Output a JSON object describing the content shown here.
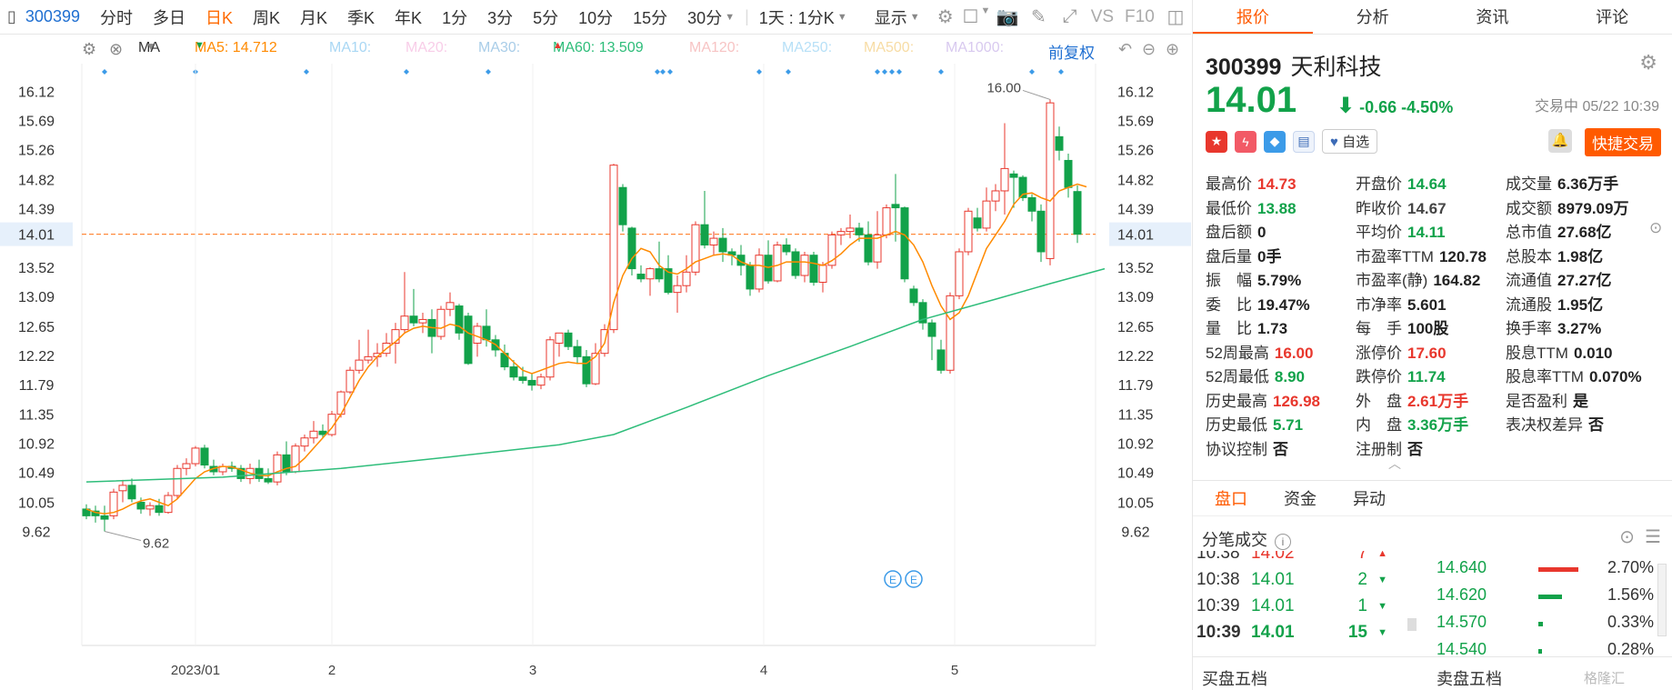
{
  "toolbar": {
    "code": "300399",
    "periods": [
      "分时",
      "多日",
      "日K",
      "周K",
      "月K",
      "季K",
      "年K",
      "1分",
      "3分",
      "5分",
      "10分",
      "15分",
      "30分"
    ],
    "range": "1天 : 1分K",
    "display": "显示",
    "vs": "VS",
    "f10": "F10"
  },
  "indicator": {
    "type": "MA",
    "ma5": "MA5: 14.712",
    "ma10": "MA10:",
    "ma20": "MA20:",
    "ma30": "MA30:",
    "ma60": "MA60: 13.509",
    "ma120": "MA120:",
    "ma250": "MA250:",
    "ma500": "MA500:",
    "ma1000": "MA1000:",
    "adjust": "前复权",
    "ma5_color": "#ff8a00",
    "ma60_color": "#2ebd7a"
  },
  "chart_data": {
    "type": "candlestick",
    "title": "",
    "ylim": [
      9.4,
      16.5
    ],
    "y_ticks": [
      "16.12",
      "15.69",
      "15.26",
      "14.82",
      "14.39",
      "14.01",
      "13.52",
      "13.09",
      "12.65",
      "12.22",
      "11.79",
      "11.35",
      "10.92",
      "10.49",
      "10.05",
      "9.62"
    ],
    "x_ticks": [
      "2023/01",
      "2",
      "3",
      "4",
      "5"
    ],
    "current_price": "14.01",
    "max_label": "16.00",
    "min_label": "9.62",
    "colors": {
      "up": "#e8372d",
      "down": "#12a24a",
      "ma5": "#ff8a00",
      "ma60": "#2ebd7a",
      "current_line": "#ff8a3d"
    },
    "candles": [
      {
        "o": 9.95,
        "h": 10.02,
        "l": 9.8,
        "c": 9.85
      },
      {
        "o": 9.92,
        "h": 10.0,
        "l": 9.75,
        "c": 9.85
      },
      {
        "o": 9.85,
        "h": 10.0,
        "l": 9.62,
        "c": 9.8
      },
      {
        "o": 9.85,
        "h": 10.25,
        "l": 9.8,
        "c": 10.2
      },
      {
        "o": 10.22,
        "h": 10.38,
        "l": 10.05,
        "c": 10.3
      },
      {
        "o": 10.3,
        "h": 10.4,
        "l": 10.05,
        "c": 10.1
      },
      {
        "o": 10.05,
        "h": 10.12,
        "l": 9.88,
        "c": 9.95
      },
      {
        "o": 9.95,
        "h": 10.05,
        "l": 9.85,
        "c": 10.0
      },
      {
        "o": 10.0,
        "h": 10.1,
        "l": 9.85,
        "c": 9.9
      },
      {
        "o": 9.9,
        "h": 10.2,
        "l": 9.88,
        "c": 10.15
      },
      {
        "o": 10.15,
        "h": 10.6,
        "l": 10.1,
        "c": 10.55
      },
      {
        "o": 10.55,
        "h": 10.7,
        "l": 10.45,
        "c": 10.62
      },
      {
        "o": 10.62,
        "h": 10.88,
        "l": 10.58,
        "c": 10.85
      },
      {
        "o": 10.85,
        "h": 10.9,
        "l": 10.55,
        "c": 10.6
      },
      {
        "o": 10.58,
        "h": 10.68,
        "l": 10.45,
        "c": 10.5
      },
      {
        "o": 10.5,
        "h": 10.62,
        "l": 10.45,
        "c": 10.58
      },
      {
        "o": 10.58,
        "h": 10.65,
        "l": 10.5,
        "c": 10.55
      },
      {
        "o": 10.55,
        "h": 10.6,
        "l": 10.35,
        "c": 10.4
      },
      {
        "o": 10.4,
        "h": 10.62,
        "l": 10.32,
        "c": 10.55
      },
      {
        "o": 10.55,
        "h": 10.68,
        "l": 10.35,
        "c": 10.4
      },
      {
        "o": 10.4,
        "h": 10.55,
        "l": 10.32,
        "c": 10.35
      },
      {
        "o": 10.35,
        "h": 10.8,
        "l": 10.3,
        "c": 10.75
      },
      {
        "o": 10.75,
        "h": 10.95,
        "l": 10.45,
        "c": 10.5
      },
      {
        "o": 10.5,
        "h": 10.92,
        "l": 10.48,
        "c": 10.88
      },
      {
        "o": 10.88,
        "h": 11.05,
        "l": 10.8,
        "c": 11.0
      },
      {
        "o": 11.0,
        "h": 11.25,
        "l": 10.92,
        "c": 11.1
      },
      {
        "o": 11.1,
        "h": 11.2,
        "l": 11.0,
        "c": 11.05
      },
      {
        "o": 11.05,
        "h": 11.4,
        "l": 11.02,
        "c": 11.35
      },
      {
        "o": 11.35,
        "h": 11.7,
        "l": 11.3,
        "c": 11.68
      },
      {
        "o": 11.68,
        "h": 12.05,
        "l": 11.65,
        "c": 12.0
      },
      {
        "o": 12.0,
        "h": 12.45,
        "l": 11.95,
        "c": 12.15
      },
      {
        "o": 12.15,
        "h": 12.6,
        "l": 12.1,
        "c": 12.2
      },
      {
        "o": 12.2,
        "h": 12.4,
        "l": 12.05,
        "c": 12.25
      },
      {
        "o": 12.25,
        "h": 12.55,
        "l": 12.2,
        "c": 12.4
      },
      {
        "o": 12.4,
        "h": 12.7,
        "l": 12.1,
        "c": 12.6
      },
      {
        "o": 12.6,
        "h": 13.45,
        "l": 12.55,
        "c": 12.8
      },
      {
        "o": 12.8,
        "h": 13.2,
        "l": 12.65,
        "c": 12.7
      },
      {
        "o": 12.7,
        "h": 12.85,
        "l": 12.55,
        "c": 12.75
      },
      {
        "o": 12.75,
        "h": 12.9,
        "l": 12.25,
        "c": 12.5
      },
      {
        "o": 12.5,
        "h": 12.95,
        "l": 12.45,
        "c": 12.9
      },
      {
        "o": 12.9,
        "h": 13.15,
        "l": 12.8,
        "c": 13.0
      },
      {
        "o": 12.95,
        "h": 12.98,
        "l": 12.45,
        "c": 12.55
      },
      {
        "o": 12.8,
        "h": 12.85,
        "l": 12.08,
        "c": 12.1
      },
      {
        "o": 12.4,
        "h": 12.7,
        "l": 12.2,
        "c": 12.65
      },
      {
        "o": 12.65,
        "h": 12.9,
        "l": 12.35,
        "c": 12.45
      },
      {
        "o": 12.45,
        "h": 12.52,
        "l": 12.2,
        "c": 12.3
      },
      {
        "o": 12.25,
        "h": 12.38,
        "l": 12.0,
        "c": 12.05
      },
      {
        "o": 12.05,
        "h": 12.15,
        "l": 11.85,
        "c": 11.9
      },
      {
        "o": 11.9,
        "h": 12.05,
        "l": 11.8,
        "c": 11.85
      },
      {
        "o": 11.85,
        "h": 11.95,
        "l": 11.7,
        "c": 11.78
      },
      {
        "o": 11.78,
        "h": 11.95,
        "l": 11.72,
        "c": 11.9
      },
      {
        "o": 11.9,
        "h": 12.5,
        "l": 11.85,
        "c": 12.45
      },
      {
        "o": 12.4,
        "h": 12.55,
        "l": 12.2,
        "c": 12.55
      },
      {
        "o": 12.55,
        "h": 12.6,
        "l": 12.3,
        "c": 12.35
      },
      {
        "o": 12.35,
        "h": 12.45,
        "l": 12.1,
        "c": 12.2
      },
      {
        "o": 12.2,
        "h": 12.3,
        "l": 11.75,
        "c": 11.8
      },
      {
        "o": 11.8,
        "h": 12.4,
        "l": 11.78,
        "c": 12.25
      },
      {
        "o": 12.25,
        "h": 12.68,
        "l": 12.2,
        "c": 12.6
      },
      {
        "o": 12.6,
        "h": 15.05,
        "l": 12.55,
        "c": 15.03
      },
      {
        "o": 14.7,
        "h": 14.75,
        "l": 14.05,
        "c": 14.15
      },
      {
        "o": 14.1,
        "h": 14.12,
        "l": 13.4,
        "c": 13.5
      },
      {
        "o": 13.42,
        "h": 13.55,
        "l": 13.3,
        "c": 13.35
      },
      {
        "o": 13.35,
        "h": 13.52,
        "l": 13.1,
        "c": 13.5
      },
      {
        "o": 13.5,
        "h": 13.9,
        "l": 13.3,
        "c": 13.35
      },
      {
        "o": 13.5,
        "h": 13.7,
        "l": 13.12,
        "c": 13.15
      },
      {
        "o": 13.15,
        "h": 13.4,
        "l": 12.85,
        "c": 13.25
      },
      {
        "o": 13.25,
        "h": 13.7,
        "l": 13.15,
        "c": 13.45
      },
      {
        "o": 13.45,
        "h": 14.2,
        "l": 13.4,
        "c": 14.15
      },
      {
        "o": 14.15,
        "h": 14.65,
        "l": 13.8,
        "c": 13.85
      },
      {
        "o": 13.85,
        "h": 14.05,
        "l": 13.7,
        "c": 13.95
      },
      {
        "o": 13.95,
        "h": 14.1,
        "l": 13.6,
        "c": 13.75
      },
      {
        "o": 13.75,
        "h": 13.8,
        "l": 13.55,
        "c": 13.7
      },
      {
        "o": 13.7,
        "h": 13.85,
        "l": 13.4,
        "c": 13.55
      },
      {
        "o": 13.55,
        "h": 13.6,
        "l": 13.1,
        "c": 13.2
      },
      {
        "o": 13.2,
        "h": 13.8,
        "l": 13.15,
        "c": 13.7
      },
      {
        "o": 13.7,
        "h": 13.92,
        "l": 13.28,
        "c": 13.32
      },
      {
        "o": 13.32,
        "h": 13.9,
        "l": 13.3,
        "c": 13.85
      },
      {
        "o": 13.85,
        "h": 13.95,
        "l": 13.7,
        "c": 13.75
      },
      {
        "o": 13.75,
        "h": 13.8,
        "l": 13.35,
        "c": 13.4
      },
      {
        "o": 13.4,
        "h": 13.75,
        "l": 13.3,
        "c": 13.7
      },
      {
        "o": 13.7,
        "h": 13.75,
        "l": 13.25,
        "c": 13.3
      },
      {
        "o": 13.3,
        "h": 13.6,
        "l": 13.15,
        "c": 13.55
      },
      {
        "o": 13.55,
        "h": 14.05,
        "l": 13.5,
        "c": 14.0
      },
      {
        "o": 14.0,
        "h": 14.1,
        "l": 13.85,
        "c": 14.05
      },
      {
        "o": 14.05,
        "h": 14.3,
        "l": 13.95,
        "c": 14.1
      },
      {
        "o": 14.1,
        "h": 14.18,
        "l": 13.9,
        "c": 14.0
      },
      {
        "o": 14.0,
        "h": 14.2,
        "l": 13.55,
        "c": 13.6
      },
      {
        "o": 13.6,
        "h": 14.35,
        "l": 13.5,
        "c": 14.0
      },
      {
        "o": 14.0,
        "h": 14.45,
        "l": 13.95,
        "c": 14.4
      },
      {
        "o": 14.45,
        "h": 14.9,
        "l": 13.9,
        "c": 14.4
      },
      {
        "o": 14.4,
        "h": 14.42,
        "l": 13.3,
        "c": 13.35
      },
      {
        "o": 13.2,
        "h": 13.25,
        "l": 12.95,
        "c": 13.0
      },
      {
        "o": 13.0,
        "h": 13.05,
        "l": 12.6,
        "c": 12.7
      },
      {
        "o": 12.7,
        "h": 12.75,
        "l": 12.15,
        "c": 12.5
      },
      {
        "o": 12.3,
        "h": 12.45,
        "l": 11.95,
        "c": 12.0
      },
      {
        "o": 12.0,
        "h": 13.15,
        "l": 11.95,
        "c": 13.1
      },
      {
        "o": 13.1,
        "h": 13.8,
        "l": 13.05,
        "c": 13.75
      },
      {
        "o": 13.75,
        "h": 14.4,
        "l": 13.7,
        "c": 14.35
      },
      {
        "o": 14.25,
        "h": 14.4,
        "l": 14.05,
        "c": 14.1
      },
      {
        "o": 14.1,
        "h": 14.7,
        "l": 14.05,
        "c": 14.5
      },
      {
        "o": 14.5,
        "h": 14.75,
        "l": 14.35,
        "c": 14.65
      },
      {
        "o": 14.65,
        "h": 15.65,
        "l": 14.3,
        "c": 14.98
      },
      {
        "o": 14.9,
        "h": 14.95,
        "l": 14.4,
        "c": 14.85
      },
      {
        "o": 14.85,
        "h": 14.88,
        "l": 14.5,
        "c": 14.55
      },
      {
        "o": 14.55,
        "h": 14.6,
        "l": 14.2,
        "c": 14.35
      },
      {
        "o": 14.35,
        "h": 14.45,
        "l": 13.6,
        "c": 13.75
      },
      {
        "o": 13.65,
        "h": 16.0,
        "l": 13.55,
        "c": 15.95
      },
      {
        "o": 15.45,
        "h": 15.6,
        "l": 15.1,
        "c": 15.25
      },
      {
        "o": 15.1,
        "h": 15.2,
        "l": 14.55,
        "c": 14.7
      },
      {
        "o": 14.64,
        "h": 14.73,
        "l": 13.88,
        "c": 14.01
      }
    ],
    "ma5": [
      9.95,
      9.9,
      9.88,
      9.9,
      9.95,
      10.02,
      10.07,
      10.1,
      10.05,
      10.0,
      10.1,
      10.25,
      10.4,
      10.5,
      10.55,
      10.58,
      10.57,
      10.53,
      10.48,
      10.45,
      10.44,
      10.5,
      10.55,
      10.58,
      10.7,
      10.85,
      11.0,
      11.15,
      11.35,
      11.6,
      11.85,
      12.05,
      12.2,
      12.32,
      12.42,
      12.55,
      12.62,
      12.65,
      12.63,
      12.62,
      12.68,
      12.65,
      12.55,
      12.5,
      12.45,
      12.38,
      12.25,
      12.12,
      12.0,
      11.95,
      12.0,
      12.05,
      12.1,
      12.12,
      12.1,
      12.1,
      12.2,
      12.4,
      13.0,
      13.4,
      13.65,
      13.8,
      13.75,
      13.55,
      13.45,
      13.42,
      13.5,
      13.6,
      13.65,
      13.7,
      13.72,
      13.7,
      13.6,
      13.55,
      13.55,
      13.52,
      13.55,
      13.6,
      13.6,
      13.6,
      13.58,
      13.55,
      13.62,
      13.72,
      13.85,
      13.95,
      13.95,
      13.95,
      14.0,
      14.05,
      14.0,
      13.85,
      13.6,
      13.25,
      12.95,
      12.75,
      12.85,
      13.1,
      13.45,
      13.8,
      14.0,
      14.2,
      14.45,
      14.6,
      14.62,
      14.55,
      14.5,
      14.65,
      14.7,
      14.75,
      14.71
    ],
    "ma60": [
      {
        "i": 0,
        "v": 10.35
      },
      {
        "i": 15,
        "v": 10.42
      },
      {
        "i": 28,
        "v": 10.55
      },
      {
        "i": 40,
        "v": 10.72
      },
      {
        "i": 52,
        "v": 10.9
      },
      {
        "i": 58,
        "v": 11.05
      },
      {
        "i": 66,
        "v": 11.45
      },
      {
        "i": 75,
        "v": 11.92
      },
      {
        "i": 84,
        "v": 12.35
      },
      {
        "i": 92,
        "v": 12.75
      },
      {
        "i": 100,
        "v": 13.05
      },
      {
        "i": 106,
        "v": 13.28
      },
      {
        "i": 112,
        "v": 13.5
      }
    ]
  },
  "right": {
    "tabs": [
      "报价",
      "分析",
      "资讯",
      "评论"
    ],
    "code": "300399",
    "name": "天利科技",
    "price": "14.01",
    "change": "-0.66",
    "pct": "-4.50%",
    "status": "交易中 05/22 10:39",
    "watch": "自选",
    "quick_trade": "快捷交易",
    "stats": [
      [
        {
          "k": "最高价",
          "v": "14.73",
          "c": "red"
        },
        {
          "k": "开盘价",
          "v": "14.64",
          "c": "green"
        },
        {
          "k": "成交量",
          "v": "6.36万手",
          "c": "dark"
        }
      ],
      [
        {
          "k": "最低价",
          "v": "13.88",
          "c": "green"
        },
        {
          "k": "昨收价",
          "v": "14.67",
          "c": "grey"
        },
        {
          "k": "成交额",
          "v": "8979.09万",
          "c": "dark"
        }
      ],
      [
        {
          "k": "盘后额",
          "v": "0",
          "c": "dark"
        },
        {
          "k": "平均价",
          "v": "14.11",
          "c": "green"
        },
        {
          "k": "总市值",
          "v": "27.68亿",
          "c": "dark"
        }
      ],
      [
        {
          "k": "盘后量",
          "v": "0手",
          "c": "dark"
        },
        {
          "k": "市盈率TTM",
          "v": "120.78",
          "c": "dark"
        },
        {
          "k": "总股本",
          "v": "1.98亿",
          "c": "dark"
        }
      ],
      [
        {
          "k": "振　幅",
          "v": "5.79%",
          "c": "dark"
        },
        {
          "k": "市盈率(静)",
          "v": "164.82",
          "c": "dark"
        },
        {
          "k": "流通值",
          "v": "27.27亿",
          "c": "dark"
        }
      ],
      [
        {
          "k": "委　比",
          "v": "19.47%",
          "c": "dark"
        },
        {
          "k": "市净率",
          "v": "5.601",
          "c": "dark"
        },
        {
          "k": "流通股",
          "v": "1.95亿",
          "c": "dark"
        }
      ],
      [
        {
          "k": "量　比",
          "v": "1.73",
          "c": "dark"
        },
        {
          "k": "每　手",
          "v": "100股",
          "c": "dark"
        },
        {
          "k": "换手率",
          "v": "3.27%",
          "c": "dark"
        }
      ],
      [
        {
          "k": "52周最高",
          "v": "16.00",
          "c": "red"
        },
        {
          "k": "涨停价",
          "v": "17.60",
          "c": "red"
        },
        {
          "k": "股息TTM",
          "v": "0.010",
          "c": "dark"
        }
      ],
      [
        {
          "k": "52周最低",
          "v": "8.90",
          "c": "green"
        },
        {
          "k": "跌停价",
          "v": "11.74",
          "c": "green"
        },
        {
          "k": "股息率TTM",
          "v": "0.070%",
          "c": "dark"
        }
      ],
      [
        {
          "k": "历史最高",
          "v": "126.98",
          "c": "red"
        },
        {
          "k": "外　盘",
          "v": "2.61万手",
          "c": "red"
        },
        {
          "k": "是否盈利",
          "v": "是",
          "c": "dark"
        }
      ],
      [
        {
          "k": "历史最低",
          "v": "5.71",
          "c": "green"
        },
        {
          "k": "内　盘",
          "v": "3.36万手",
          "c": "green"
        },
        {
          "k": "表决权差异",
          "v": "否",
          "c": "dark"
        }
      ],
      [
        {
          "k": "协议控制",
          "v": "否",
          "c": "dark"
        },
        {
          "k": "注册制",
          "v": "否",
          "c": "dark"
        },
        {
          "k": "",
          "v": "",
          "c": "dark"
        }
      ]
    ],
    "subtabs": [
      "盘口",
      "资金",
      "异动"
    ],
    "ticks_title": "分笔成交",
    "ticks": [
      {
        "t": "10:38",
        "p": "14.02",
        "n": "7",
        "dir": "up"
      },
      {
        "t": "10:38",
        "p": "14.01",
        "n": "2",
        "dir": "down"
      },
      {
        "t": "10:39",
        "p": "14.01",
        "n": "1",
        "dir": "down"
      },
      {
        "t": "10:39",
        "p": "14.01",
        "n": "15",
        "dir": "down"
      }
    ],
    "distribution": [
      {
        "price": "14.640",
        "pct": "2.70%",
        "color": "#e8372d",
        "frac": 1.0
      },
      {
        "price": "14.620",
        "pct": "1.56%",
        "color": "#12a24a",
        "frac": 0.58
      },
      {
        "price": "14.570",
        "pct": "0.33%",
        "color": "#12a24a",
        "frac": 0.12
      },
      {
        "price": "14.540",
        "pct": "0.28%",
        "color": "#12a24a",
        "frac": 0.1
      }
    ],
    "buy5": "买盘五档",
    "sell5": "卖盘五档",
    "watermark": "格隆汇"
  }
}
